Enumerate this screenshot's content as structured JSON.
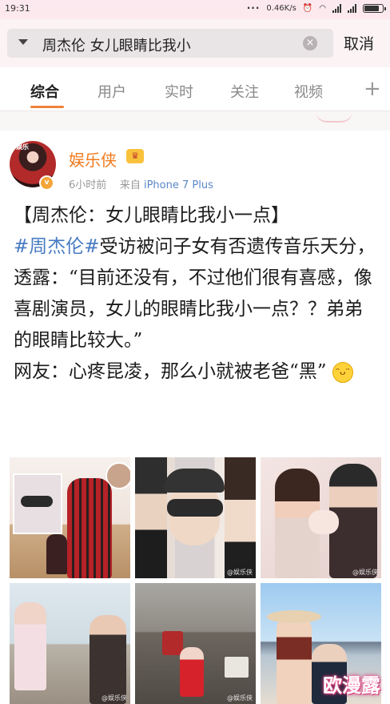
{
  "status_bar": {
    "time": "19:31",
    "dots": "···",
    "speed": "0.46K/s"
  },
  "search": {
    "query": "周杰伦 女儿眼睛比我小",
    "clear_icon": "close-circle-icon",
    "cancel_label": "取消"
  },
  "tabs": [
    {
      "label": "综合",
      "active": true
    },
    {
      "label": "用户",
      "active": false
    },
    {
      "label": "实时",
      "active": false
    },
    {
      "label": "关注",
      "active": false
    },
    {
      "label": "视频",
      "active": false
    }
  ],
  "tab_add_label": "+",
  "post": {
    "author": "娱乐侠",
    "vip_badge": "vip-crown-icon",
    "time": "6小时前",
    "source_prefix": "来自",
    "source": "iPhone 7 Plus",
    "title": "【周杰伦：女儿眼睛比我小一点】",
    "hashtag": "#周杰伦#",
    "body1": "受访被问子女有否遗传音乐天分，透露：“目前还没有，不过他们很有喜感，像喜剧演员，女儿的眼睛比我小一点？？弟弟的眼睛比较大。”",
    "body2": "网友：心疼昆凌，那么小就被老爸“黑”",
    "emoji": "laugh-emoji-icon",
    "images": [
      {
        "name": "photo-1",
        "watermark": ""
      },
      {
        "name": "photo-2",
        "watermark": "@娱乐侠"
      },
      {
        "name": "photo-3",
        "watermark": "@娱乐侠"
      },
      {
        "name": "photo-4",
        "watermark": "@娱乐侠"
      },
      {
        "name": "photo-5",
        "watermark": "@娱乐侠"
      },
      {
        "name": "photo-6",
        "watermark": ""
      }
    ]
  },
  "site_watermark": "欧漫露",
  "colors": {
    "accent": "#f1813a",
    "username": "#f07a1d",
    "hashtag": "#4a7cc3",
    "source": "#5b87c6"
  }
}
